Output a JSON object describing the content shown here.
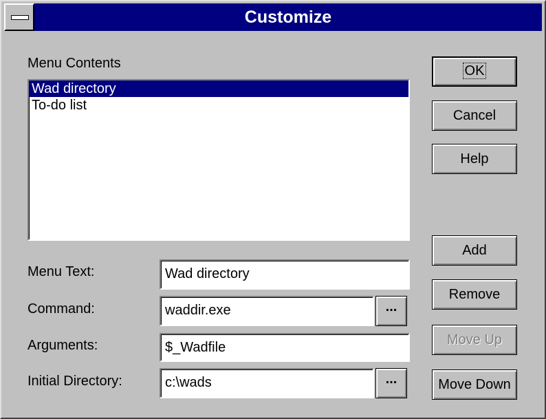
{
  "window": {
    "title": "Customize"
  },
  "menu_contents": {
    "label": "Menu Contents",
    "items": [
      "Wad directory",
      "To-do list"
    ],
    "selected_index": 0
  },
  "fields": {
    "menu_text": {
      "label": "Menu Text:",
      "value": "Wad directory"
    },
    "command": {
      "label": "Command:",
      "value": "waddir.exe",
      "browse_label": "..."
    },
    "arguments": {
      "label": "Arguments:",
      "value": "$_Wadfile"
    },
    "initial_directory": {
      "label": "Initial Directory:",
      "value": "c:\\wads",
      "browse_label": "..."
    }
  },
  "buttons": {
    "ok": "OK",
    "cancel": "Cancel",
    "help": "Help",
    "add": "Add",
    "remove": "Remove",
    "move_up": "Move Up",
    "move_down": "Move Down"
  },
  "colors": {
    "titlebar": "#000080",
    "face": "#c0c0c0",
    "selection": "#000080"
  }
}
